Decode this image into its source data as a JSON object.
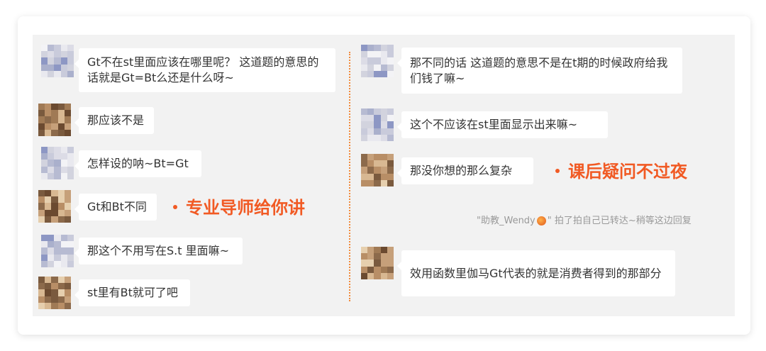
{
  "left_messages": [
    {
      "text": "Gt不在st里面应该在哪里呢？ 这道题的意思的话就是Gt=Bt么还是什么呀~",
      "avatar": "blue"
    },
    {
      "text": "那应该不是",
      "avatar": "brown"
    },
    {
      "text": "怎样设的呐~Bt=Gt",
      "avatar": "blue"
    },
    {
      "text": "Gt和Bt不同",
      "avatar": "brown"
    },
    {
      "text": "那这个不用写在S.t 里面嘛~",
      "avatar": "blue"
    },
    {
      "text": "st里有Bt就可了吧",
      "avatar": "brown"
    }
  ],
  "right_messages": [
    {
      "text": "那不同的话 这道题的意思不是在t期的时候政府给我们钱了嘛~",
      "avatar": "blue"
    },
    {
      "text": "这个不应该在st里面显示出来嘛~",
      "avatar": "blue"
    },
    {
      "text": "那没你想的那么复杂",
      "avatar": "brown"
    },
    {
      "text": "效用函数里伽马Gt代表的就是消费者得到的那部分",
      "avatar": "brown"
    }
  ],
  "taglines": {
    "left": "专业导师给你讲",
    "right": "课后疑问不过夜"
  },
  "notice": {
    "prefix": "\"助教_Wendy",
    "suffix": "\" 拍了拍自己已转达~稍等这边回复",
    "icon": "peach-emoji-icon"
  },
  "colors": {
    "accent": "#f15a24",
    "divider": "#f28a3a",
    "panel": "#f2f2f2"
  }
}
